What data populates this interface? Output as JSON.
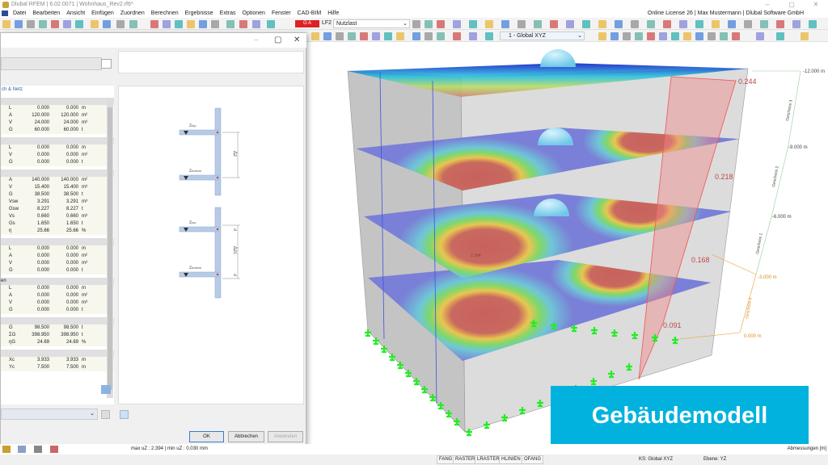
{
  "window": {
    "title": "Dlubal RFEM | 6.02.0071 | Wohnhaus_Rev2.rf6*",
    "license": "Online License 26 | Max Mustermann | Dlubal Software GmbH"
  },
  "menu": [
    "Datei",
    "Bearbeiten",
    "Ansicht",
    "Einfügen",
    "Zuordnen",
    "Berechnen",
    "Ergebnisse",
    "Extras",
    "Optionen",
    "Fenster",
    "CAD-BIM",
    "Hilfe"
  ],
  "toolbar": {
    "load_case_badge": "G A",
    "load_case_id": "LF2",
    "load_case_name": "Nutzlast",
    "coord_system": "1 - Global XYZ"
  },
  "dialog": {
    "section_header": "ch & Netz",
    "groups": [
      {
        "label": "",
        "rows": [
          [
            "L",
            "0.000",
            "0.000",
            "m"
          ],
          [
            "A",
            "120.000",
            "120.000",
            "m²"
          ],
          [
            "V",
            "24.000",
            "24.000",
            "m³"
          ],
          [
            "G",
            "60.000",
            "60.000",
            "t"
          ]
        ]
      },
      {
        "label": "",
        "rows": [
          [
            "L",
            "0.000",
            "0.000",
            "m"
          ],
          [
            "V",
            "0.000",
            "0.000",
            "m³"
          ],
          [
            "G",
            "0.000",
            "0.000",
            "t"
          ]
        ]
      },
      {
        "label": "",
        "rows": [
          [
            "A",
            "140.000",
            "140.000",
            "m²"
          ],
          [
            "V",
            "15.400",
            "15.400",
            "m³"
          ],
          [
            "G",
            "38.500",
            "38.500",
            "t"
          ],
          [
            "Vsw",
            "3.291",
            "3.291",
            "m³"
          ],
          [
            "Gsw",
            "8.227",
            "8.227",
            "t"
          ],
          [
            "Vs",
            "0.660",
            "0.660",
            "m³"
          ],
          [
            "Gs",
            "1.650",
            "1.650",
            "t"
          ],
          [
            "η",
            "25.66",
            "25.66",
            "%"
          ]
        ]
      },
      {
        "label": "",
        "rows": [
          [
            "L",
            "0.000",
            "0.000",
            "m"
          ],
          [
            "A",
            "0.000",
            "0.000",
            "m²"
          ],
          [
            "V",
            "0.000",
            "0.000",
            "m³"
          ],
          [
            "G",
            "0.000",
            "0.000",
            "t"
          ]
        ]
      },
      {
        "label": "en",
        "rows": [
          [
            "L",
            "0.000",
            "0.000",
            "m"
          ],
          [
            "A",
            "0.000",
            "0.000",
            "m²"
          ],
          [
            "V",
            "0.000",
            "0.000",
            "m³"
          ],
          [
            "G",
            "0.000",
            "0.000",
            "t"
          ]
        ]
      },
      {
        "label": "",
        "rows": [
          [
            "G",
            "98.500",
            "98.500",
            "t"
          ],
          [
            "ΣG",
            "398.950",
            "398.950",
            "t"
          ],
          [
            "ηG",
            "24.69",
            "24.69",
            "%"
          ]
        ]
      },
      {
        "label": "",
        "rows": [
          [
            "Xc",
            "3.933",
            "3.933",
            "m"
          ],
          [
            "Yc",
            "7.500",
            "7.500",
            "m"
          ]
        ]
      }
    ],
    "diagram": {
      "z_top": "z",
      "z_top_sub": "top",
      "z_bottom": "z",
      "z_bottom_sub": "bottom",
      "dz": "Δz",
      "dzc": "Δzc",
      "d": "d"
    },
    "buttons": {
      "ok": "OK",
      "cancel": "Abbrechen",
      "apply": "Anwenden"
    }
  },
  "viewport": {
    "levels": [
      "-12.000 m",
      "-9.000 m",
      "-6.000 m",
      "-3.000 m",
      "0.000 m"
    ],
    "storeys": [
      "Geschoss 3",
      "Geschoss 2",
      "Geschoss 1",
      "Geschoss 0"
    ],
    "diagram_values": [
      "0.244",
      "0.218",
      "0.168",
      "0.091"
    ],
    "max_label": "2.394",
    "banner": "Gebäudemodell"
  },
  "status": {
    "result_text": "max uZ : 2.394 | min uZ : 0.030 mm",
    "dimensions": "Abmessungen [m]",
    "snap": [
      "FANG",
      "RASTER",
      "LRASTER",
      "HLINIEN",
      "OFANG"
    ],
    "cs": "KS: Global XYZ",
    "plane": "Ebene: YZ"
  }
}
